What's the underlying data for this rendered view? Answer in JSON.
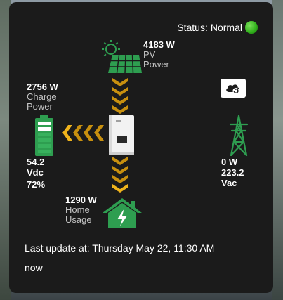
{
  "status": {
    "label": "Status:",
    "value": "Normal",
    "color": "#2fae1a"
  },
  "pv": {
    "power": "4183 W",
    "label_line1": "PV",
    "label_line2": "Power"
  },
  "charge": {
    "power": "2756 W",
    "label_line1": "Charge",
    "label_line2": "Power"
  },
  "battery": {
    "voltage": "54.2",
    "voltage_unit": "Vdc",
    "soc": "72%",
    "level_fraction": 0.72,
    "icon": "battery-icon",
    "color": "#2e9e50"
  },
  "grid": {
    "power": "0 W",
    "voltage": "223.2",
    "voltage_unit": "Vac",
    "icon": "transmission-tower-icon"
  },
  "home": {
    "power": "1290 W",
    "label_line1": "Home",
    "label_line2": "Usage",
    "icon": "home-lightning-icon"
  },
  "inverter": {
    "icon": "inverter-icon"
  },
  "refresh": {
    "icon": "cloud-refresh-icon"
  },
  "footer": {
    "last_update": "Last update at: Thursday May 22, 11:30 AM",
    "relative": "now"
  },
  "colors": {
    "flow_arrow": "#c8900f",
    "flow_arrow_bright": "#f0b41c",
    "card_bg": "#1b1b1b"
  }
}
